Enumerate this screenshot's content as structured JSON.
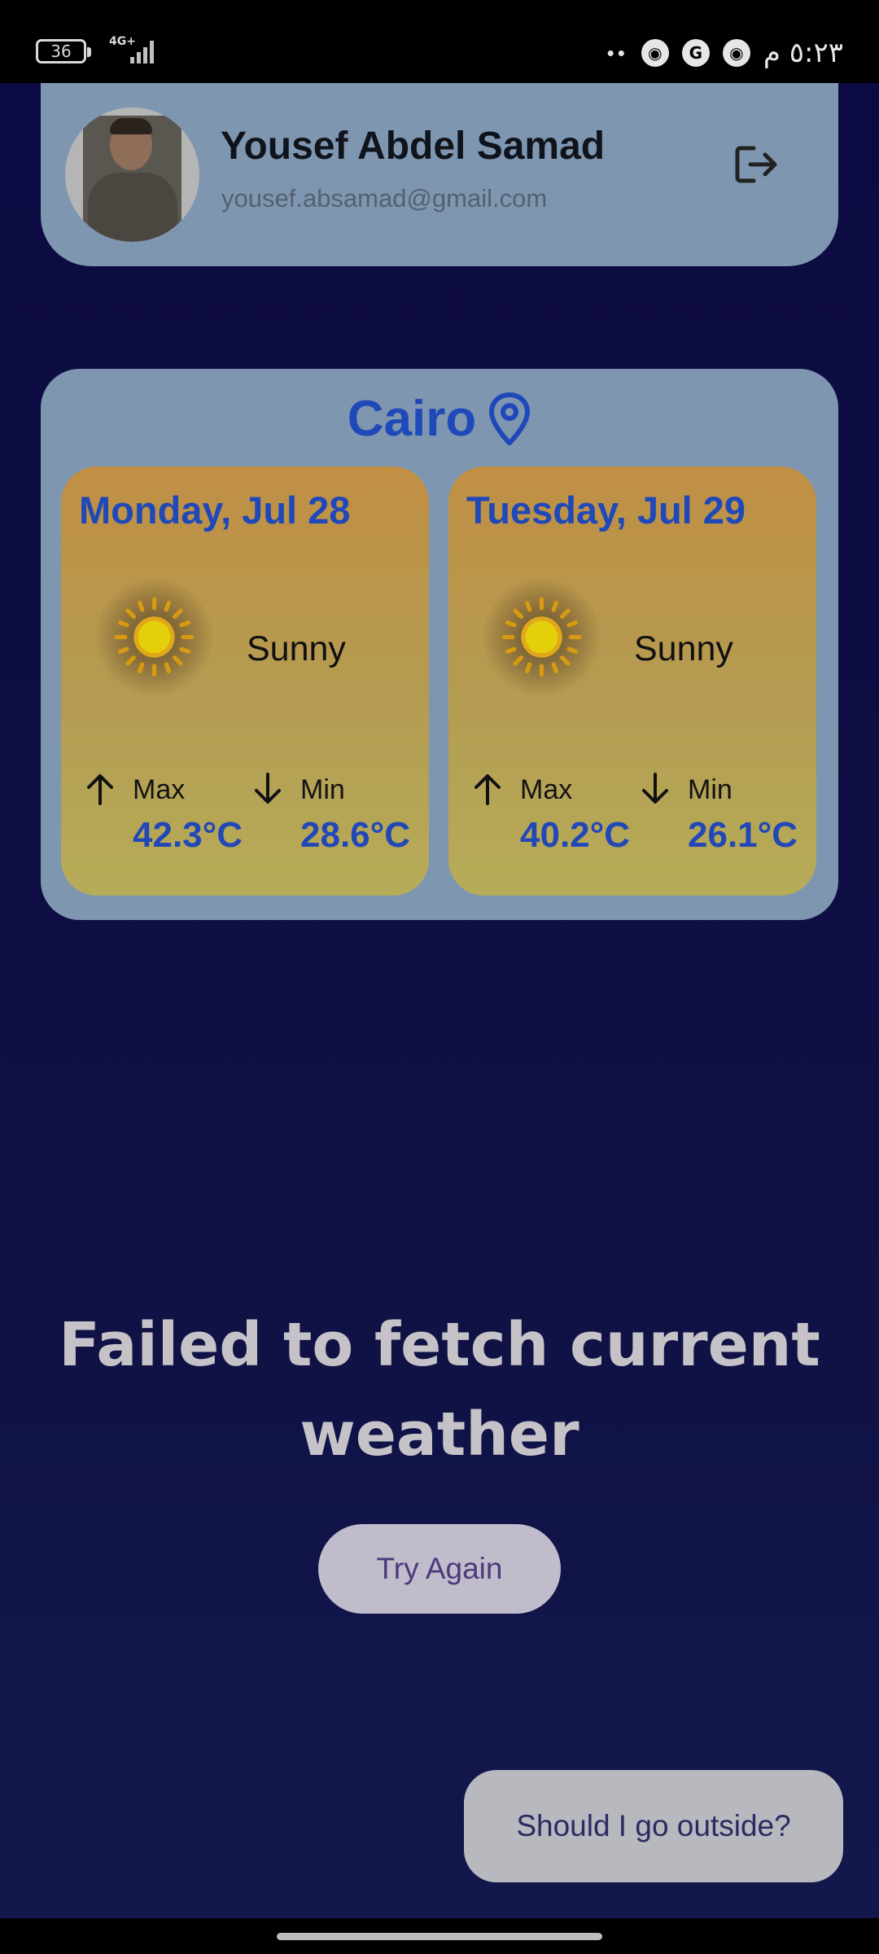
{
  "status_bar": {
    "battery": "36",
    "network": "4G+",
    "time": "٥:٢٣ م",
    "dots": "••",
    "notification_icons": [
      "chrome-icon",
      "google-icon",
      "chrome-icon"
    ]
  },
  "profile": {
    "name": "Yousef Abdel Samad",
    "email": "yousef.absamad@gmail.com",
    "logout_icon": "logout-icon"
  },
  "weather": {
    "city": "Cairo",
    "days": [
      {
        "date": "Monday, Jul 28",
        "condition": "Sunny",
        "max_label": "Max",
        "max": "42.3°C",
        "min_label": "Min",
        "min": "28.6°C"
      },
      {
        "date": "Tuesday, Jul 29",
        "condition": "Sunny",
        "max_label": "Max",
        "max": "40.2°C",
        "min_label": "Min",
        "min": "26.1°C"
      }
    ]
  },
  "error": {
    "message": "Failed to fetch current weather",
    "retry_label": "Try Again"
  },
  "fab": {
    "label": "Should I go outside?"
  },
  "colors": {
    "accent_blue": "#1f49b8",
    "card_bg": "#7f96b1",
    "background": "#0c0c3c"
  }
}
